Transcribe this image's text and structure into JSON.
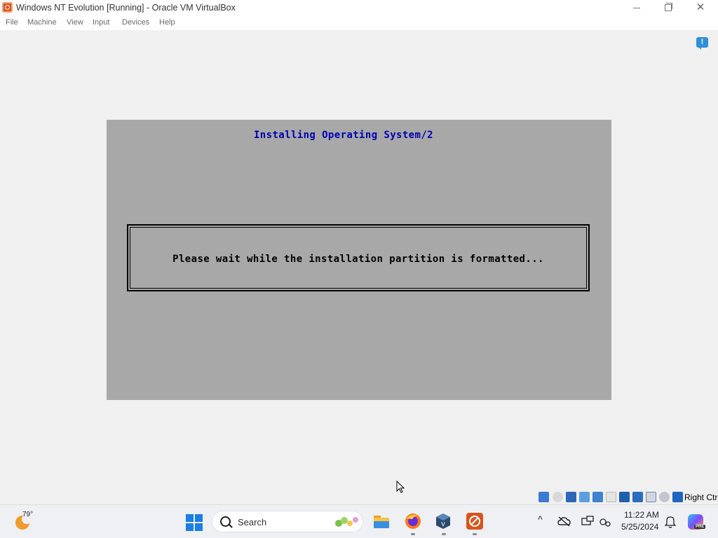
{
  "window": {
    "title": "Windows NT Evolution [Running] - Oracle VM VirtualBox",
    "controls": {
      "minimize": "—",
      "maximize": "❐",
      "close": "✕"
    }
  },
  "menu": {
    "items": [
      "File",
      "Machine",
      "View",
      "Input",
      "Devices",
      "Help"
    ]
  },
  "notification": {
    "icon": "notification-icon",
    "glyph": "!"
  },
  "vm": {
    "title": "Installing Operating System/2",
    "message": "Please wait while the installation partition is formatted...",
    "colors": {
      "background": "#a8a8a8",
      "title": "#0000b0",
      "text": "#000000"
    }
  },
  "statusbar": {
    "icons": [
      "hard-disk-icon",
      "optical-drive-icon",
      "floppy-icon",
      "audio-icon",
      "network-icon",
      "usb-icon",
      "shared-folders-icon",
      "display-icon",
      "recording-icon",
      "cpu-icon",
      "mouse-integration-icon",
      "keyboard-icon"
    ],
    "host_key": "Right Ctrl"
  },
  "taskbar": {
    "weather_temp": "79°",
    "search_placeholder": "Search",
    "apps": [
      "file-explorer-icon",
      "firefox-icon",
      "virtualbox-icon",
      "vm-window-icon"
    ],
    "tray_chevron": "^",
    "time": "11:22 AM",
    "date": "5/25/2024",
    "copilot_badge": "PRE"
  }
}
